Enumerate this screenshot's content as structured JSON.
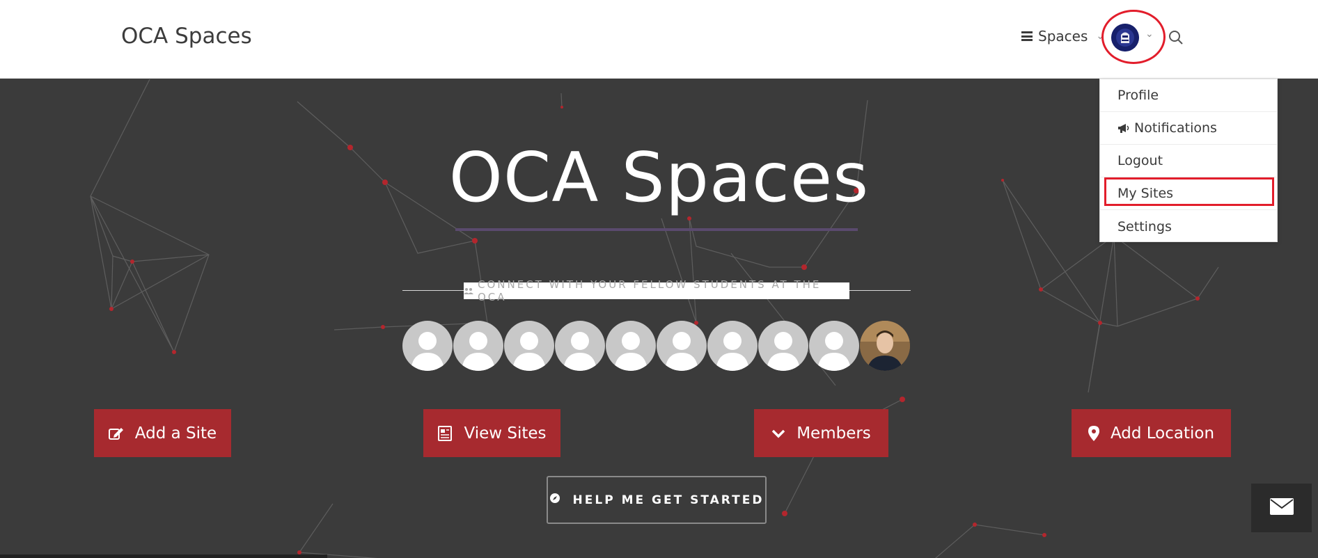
{
  "header": {
    "brand": "OCA Spaces",
    "nav_spaces_label": "Spaces",
    "user_avatar": "user-avatar-icon",
    "search_icon": "search-icon"
  },
  "user_menu": {
    "items": [
      {
        "label": "Profile",
        "icon": ""
      },
      {
        "label": "Notifications",
        "icon": "megaphone-icon"
      },
      {
        "label": "Logout",
        "icon": ""
      },
      {
        "label": "My Sites",
        "icon": ""
      },
      {
        "label": "Settings",
        "icon": ""
      }
    ]
  },
  "hero": {
    "title": "OCA Spaces",
    "tagline": "CONNECT WITH YOUR FELLOW STUDENTS AT THE OCA",
    "tagline_icon": "users-icon",
    "member_avatars": [
      "default-avatar",
      "default-avatar",
      "default-avatar",
      "default-avatar",
      "default-avatar",
      "default-avatar",
      "default-avatar",
      "default-avatar",
      "default-avatar",
      "member-photo"
    ]
  },
  "actions": {
    "add_site": "Add a Site",
    "view_sites": "View Sites",
    "members": "Members",
    "add_location": "Add Location",
    "help": "HELP ME GET STARTED"
  },
  "colors": {
    "accent_red": "#a72a2f",
    "hero_bg": "#3b3b3b",
    "annotation_red": "#e21d2b"
  }
}
